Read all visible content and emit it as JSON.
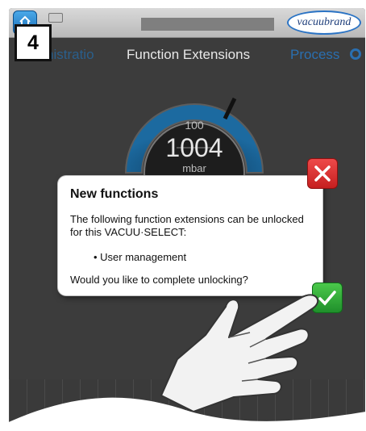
{
  "step_number": "4",
  "header": {
    "logo_text": "vacuubrand"
  },
  "tabs": {
    "left": "nistratio",
    "middle": "Function Extensions",
    "right": "Process"
  },
  "gauge": {
    "setpoint": "100",
    "value": "1004",
    "unit": "mbar"
  },
  "dialog": {
    "title": "New functions",
    "body": "The following function extensions can be unlocked for this VACUU·SELECT:",
    "item": "• User management",
    "question": "Would you like to complete unlocking?"
  },
  "colors": {
    "cancel": "#d62f2f",
    "confirm": "#2faa3a",
    "accent": "#2a6fb0"
  }
}
